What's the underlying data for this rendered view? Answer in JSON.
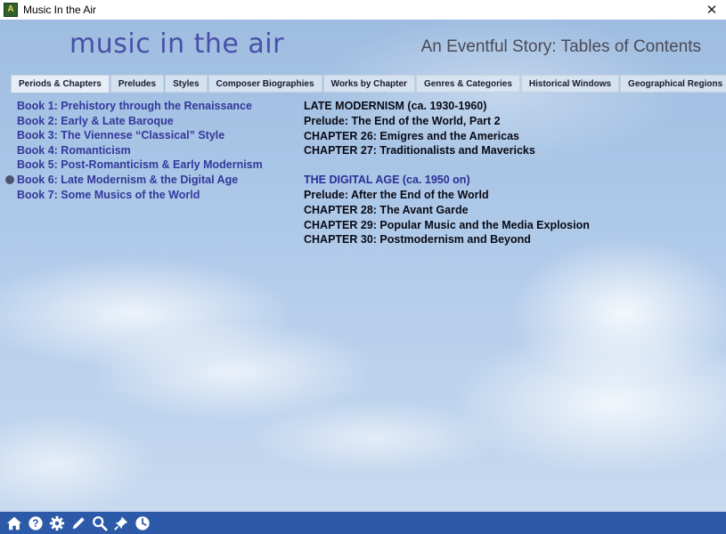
{
  "window": {
    "title": "Music In the Air",
    "close_glyph": "✕"
  },
  "header": {
    "logo_text": "music in the air",
    "heading": "An Eventful Story: Tables of Contents"
  },
  "tabs": [
    {
      "label": "Periods & Chapters",
      "active": true
    },
    {
      "label": "Preludes",
      "active": false
    },
    {
      "label": "Styles",
      "active": false
    },
    {
      "label": "Composer Biographies",
      "active": false
    },
    {
      "label": "Works by Chapter",
      "active": false
    },
    {
      "label": "Genres & Categories",
      "active": false
    },
    {
      "label": "Historical Windows",
      "active": false
    },
    {
      "label": "Geographical Regions",
      "active": false
    }
  ],
  "books": [
    {
      "label": "Book 1: Prehistory through the Renaissance",
      "selected": false
    },
    {
      "label": "Book 2: Early & Late Baroque",
      "selected": false
    },
    {
      "label": "Book 3: The Viennese “Classical” Style",
      "selected": false
    },
    {
      "label": "Book 4: Romanticism",
      "selected": false
    },
    {
      "label": "Book 5: Post-Romanticism & Early Modernism",
      "selected": false
    },
    {
      "label": "Book 6: Late Modernism & the Digital Age",
      "selected": true
    },
    {
      "label": "Book 7: Some Musics of the World",
      "selected": false
    }
  ],
  "sections": [
    {
      "heading": "LATE MODERNISM (ca. 1930-1960)",
      "items": [
        "Prelude:  The End of the World, Part 2",
        "CHAPTER 26:  Emigres and the Americas",
        "CHAPTER 27:  Traditionalists and Mavericks"
      ]
    },
    {
      "heading": "THE DIGITAL AGE (ca. 1950 on)",
      "items": [
        "Prelude:  After the End of the World",
        "CHAPTER 28:  The Avant Garde",
        "CHAPTER 29:  Popular Music and the Media Explosion",
        "CHAPTER 30:  Postmodernism and Beyond"
      ]
    }
  ],
  "toolbar": {
    "icons": [
      "home-icon",
      "help-icon",
      "gear-icon",
      "pencil-icon",
      "search-icon",
      "pin-icon",
      "clock-icon"
    ]
  },
  "colors": {
    "toolbar_bg": "#2d5aa8",
    "book_link": "#33389a",
    "digital_age_heading": "#2a2f95"
  }
}
